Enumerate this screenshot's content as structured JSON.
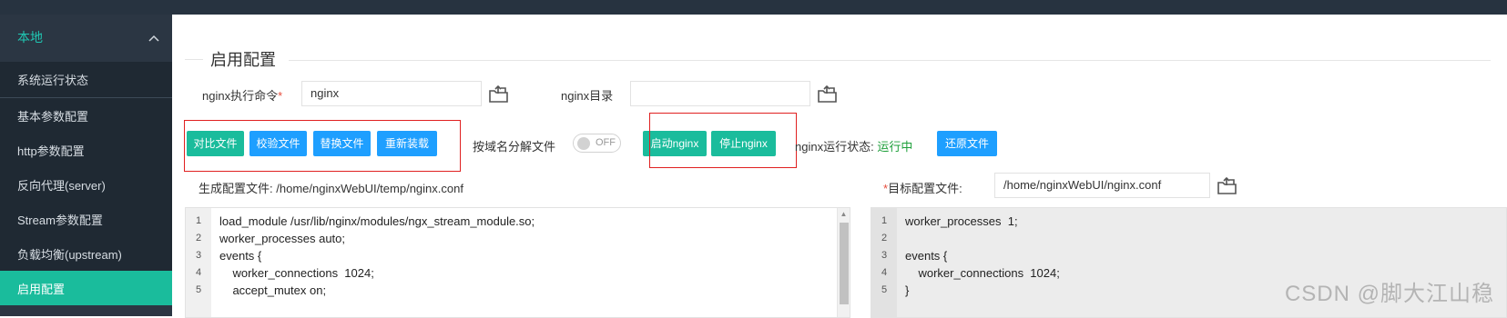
{
  "sidebar": {
    "header": "本地",
    "items": [
      {
        "label": "系统运行状态"
      },
      {
        "label": "基本参数配置"
      },
      {
        "label": "http参数配置"
      },
      {
        "label": "反向代理(server)"
      },
      {
        "label": "Stream参数配置"
      },
      {
        "label": "负载均衡(upstream)"
      },
      {
        "label": "启用配置",
        "active": true
      }
    ]
  },
  "main": {
    "title": "启用配置",
    "nginx_cmd_label": "nginx执行命令",
    "required_mark": "*",
    "nginx_cmd_value": "nginx",
    "nginx_dir_label": "nginx目录",
    "nginx_dir_value": "",
    "buttons": {
      "compare": "对比文件",
      "check": "校验文件",
      "replace": "替换文件",
      "reload": "重新装载",
      "start": "启动nginx",
      "stop": "停止nginx",
      "restore": "还原文件"
    },
    "domain_split_label": "按域名分解文件",
    "switch_text": "OFF",
    "status_label": "nginx运行状态:",
    "status_value": "运行中",
    "gen_file_label": "生成配置文件:",
    "gen_file_path": "/home/nginxWebUI/temp/nginx.conf",
    "target_file_label": "目标配置文件:",
    "target_file_path": "/home/nginxWebUI/nginx.conf"
  },
  "left_editor": {
    "line_numbers": [
      "1",
      "2",
      "3",
      "4",
      "5"
    ],
    "lines": [
      "load_module /usr/lib/nginx/modules/ngx_stream_module.so;",
      "worker_processes auto;",
      "events {",
      "    worker_connections  1024;",
      "    accept_mutex on;"
    ]
  },
  "right_editor": {
    "line_numbers": [
      "1",
      "2",
      "3",
      "4",
      "5"
    ],
    "lines": [
      "worker_processes  1;",
      "",
      "events {",
      "    worker_connections  1024;",
      "}"
    ]
  },
  "watermark": "CSDN @脚大江山稳",
  "colors": {
    "accent_teal": "#1abc9c",
    "accent_blue": "#1e9fff",
    "status_green": "#1e9f3a",
    "highlight_red": "#e02020",
    "sidebar_bg": "#2b3643"
  }
}
